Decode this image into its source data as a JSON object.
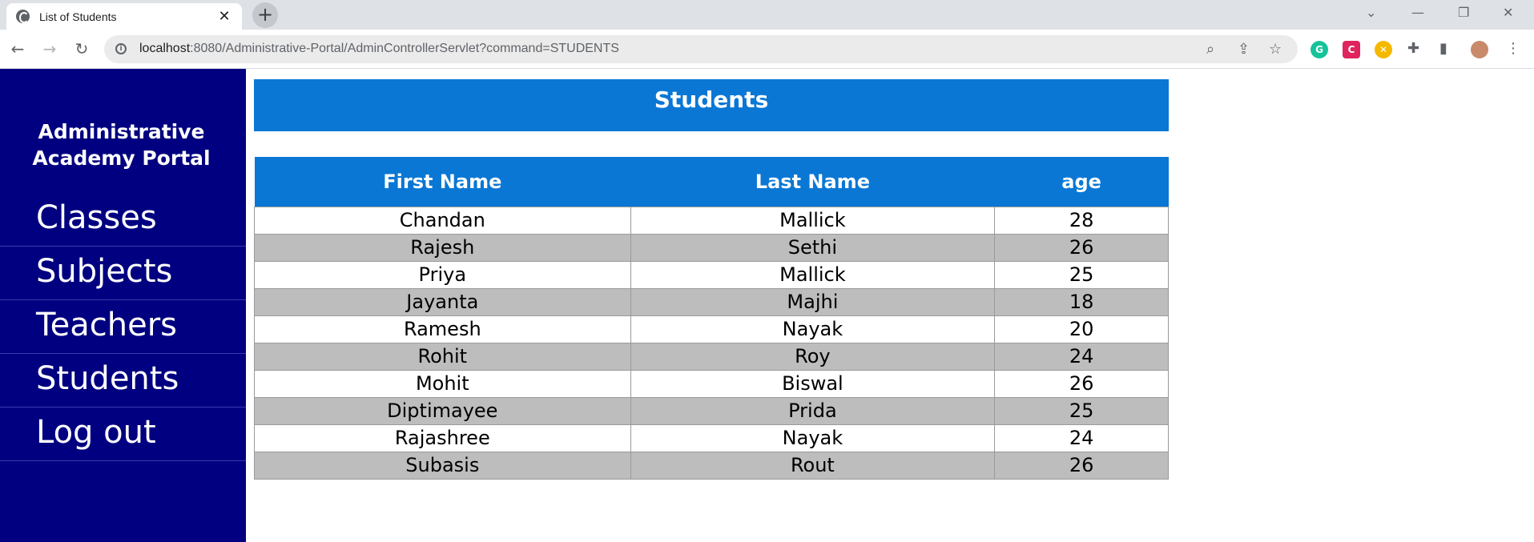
{
  "browser": {
    "tab_title": "List of Students",
    "tab_close": "✕",
    "new_tab": "+",
    "url_host": "localhost",
    "url_rest": ":8080/Administrative-Portal/AdminControllerServlet?command=STUDENTS"
  },
  "sidebar": {
    "brand_line1": "Administrative",
    "brand_line2": "Academy Portal",
    "items": [
      {
        "label": "Classes"
      },
      {
        "label": "Subjects"
      },
      {
        "label": "Teachers"
      },
      {
        "label": "Students"
      },
      {
        "label": "Log out"
      }
    ]
  },
  "main": {
    "heading": "Students",
    "columns": [
      "First Name",
      "Last Name",
      "age"
    ],
    "rows": [
      [
        "Chandan",
        "Mallick",
        "28"
      ],
      [
        "Rajesh",
        "Sethi",
        "26"
      ],
      [
        "Priya",
        "Mallick",
        "25"
      ],
      [
        "Jayanta",
        "Majhi",
        "18"
      ],
      [
        "Ramesh",
        "Nayak",
        "20"
      ],
      [
        "Rohit",
        "Roy",
        "24"
      ],
      [
        "Mohit",
        "Biswal",
        "26"
      ],
      [
        "Diptimayee",
        "Prida",
        "25"
      ],
      [
        "Rajashree",
        "Nayak",
        "24"
      ],
      [
        "Subasis",
        "Rout",
        "26"
      ]
    ]
  },
  "colors": {
    "sidebar_bg": "#000080",
    "header_blue": "#0a77d4",
    "stripe_gray": "#bdbdbd"
  }
}
